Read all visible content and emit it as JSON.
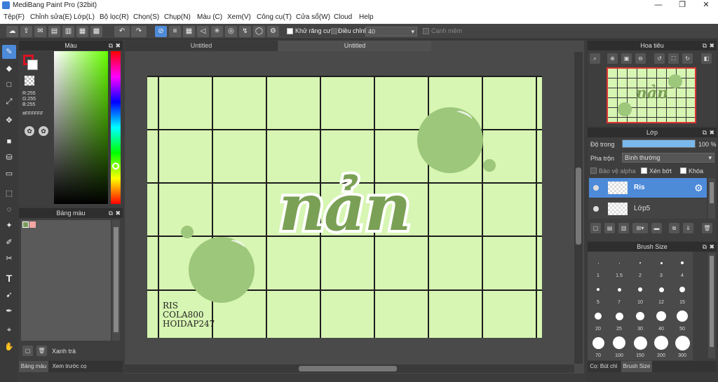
{
  "title": "MediBang Paint Pro (32bit)",
  "window_controls": {
    "minimize": "—",
    "maximize": "❐",
    "close": "✕"
  },
  "menu": [
    "Tệp(F)",
    "Chỉnh sửa(E)",
    "Lớp(L)",
    "Bộ lọc(R)",
    "Chọn(S)",
    "Chụp(N)",
    "Màu (C)",
    "Xem(V)",
    "Công cụ(T)",
    "Cửa sổ(W)",
    "Cloud",
    "Help"
  ],
  "toolbar": {
    "antialias_label": "Khử răng cưa",
    "adjust_label": "Điều chỉnh",
    "adjust_value": "40",
    "edge_label": "Cạnh mềm"
  },
  "color_panel": {
    "title": "Màu",
    "r": "R:255",
    "g": "G:255",
    "b": "B:255",
    "hex": "#FFFFFF"
  },
  "palette_panel": {
    "title": "Bảng màu",
    "item_name": "Xanh trà",
    "swatches": [
      "#7a9a5a",
      "#f4a7a0"
    ]
  },
  "bottom_tabs": [
    "Bảng màu",
    "Xem trước cọ"
  ],
  "canvas_tabs": [
    "Untitled",
    "Untitled"
  ],
  "canvas": {
    "lettering": "nản",
    "watermark": [
      "RIS",
      "COLA800",
      "HOIDAP247"
    ],
    "bg": "#d7f5b3",
    "accent": "#7aa055"
  },
  "navigator": {
    "title": "Hoa tiêu"
  },
  "layer_panel": {
    "title": "Lớp",
    "opacity_label": "Độ trong",
    "opacity_value": "100 %",
    "opacity": 1.0,
    "blend_label": "Pha trộn",
    "blend_value": "Bình thường",
    "protect_alpha": "Bảo vệ alpha",
    "clip": "Xén bớt",
    "lock": "Khóa",
    "layers": [
      "Ris",
      "Lớp5"
    ]
  },
  "brush_panel": {
    "title": "Brush Size",
    "sizes": [
      "1",
      "1.5",
      "2",
      "3",
      "4",
      "5",
      "7",
      "10",
      "12",
      "15",
      "20",
      "25",
      "30",
      "40",
      "50",
      "70",
      "100",
      "150",
      "200",
      "300"
    ]
  },
  "right_bottom_tabs": [
    "Cọ: Bút chì",
    "Brush Size"
  ]
}
